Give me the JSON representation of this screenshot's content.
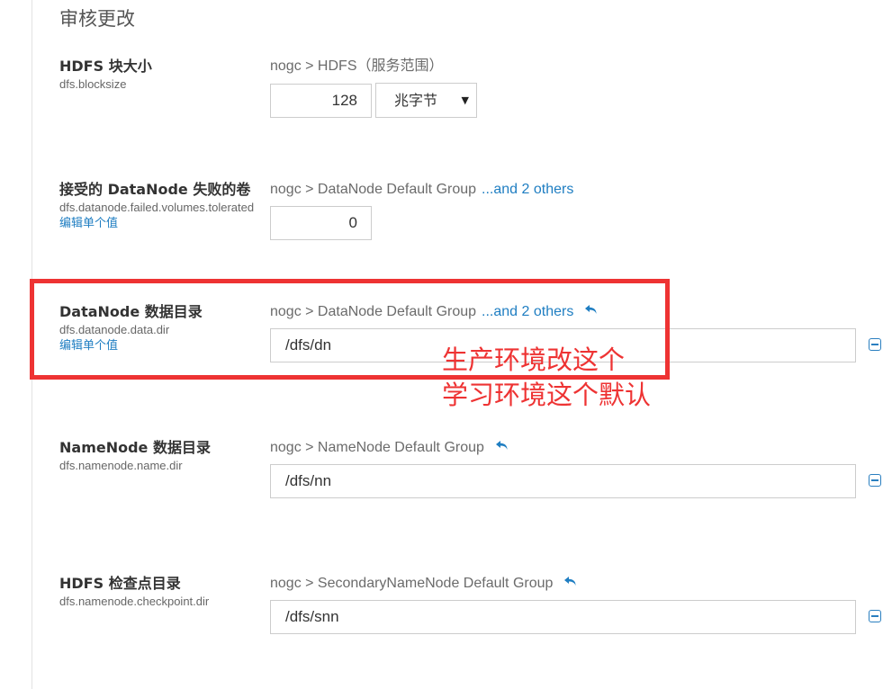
{
  "section_title": "审核更改",
  "colors": {
    "link": "#1f7ec2",
    "annotation": "#ee3333"
  },
  "properties": [
    {
      "name": "HDFS 块大小",
      "key": "dfs.blocksize",
      "scope": "nogc > HDFS（服务范围）",
      "value": "128",
      "unit": "兆字节"
    },
    {
      "name": "接受的 DataNode 失败的卷",
      "key": "dfs.datanode.failed.volumes.tolerated",
      "edit_link": "编辑单个值",
      "scope": "nogc > DataNode Default Group",
      "others": "...and 2 others",
      "value": "0"
    },
    {
      "name": "DataNode 数据目录",
      "key": "dfs.datanode.data.dir",
      "edit_link": "编辑单个值",
      "scope": "nogc > DataNode Default Group",
      "others": "...and 2 others",
      "value": "/dfs/dn"
    },
    {
      "name": "NameNode 数据目录",
      "key": "dfs.namenode.name.dir",
      "scope": "nogc > NameNode Default Group",
      "value": "/dfs/nn"
    },
    {
      "name": "HDFS 检查点目录",
      "key": "dfs.namenode.checkpoint.dir",
      "scope": "nogc > SecondaryNameNode Default Group",
      "value": "/dfs/snn"
    }
  ],
  "annotation": {
    "line1": "生产环境改这个",
    "line2": "学习环境这个默认"
  }
}
